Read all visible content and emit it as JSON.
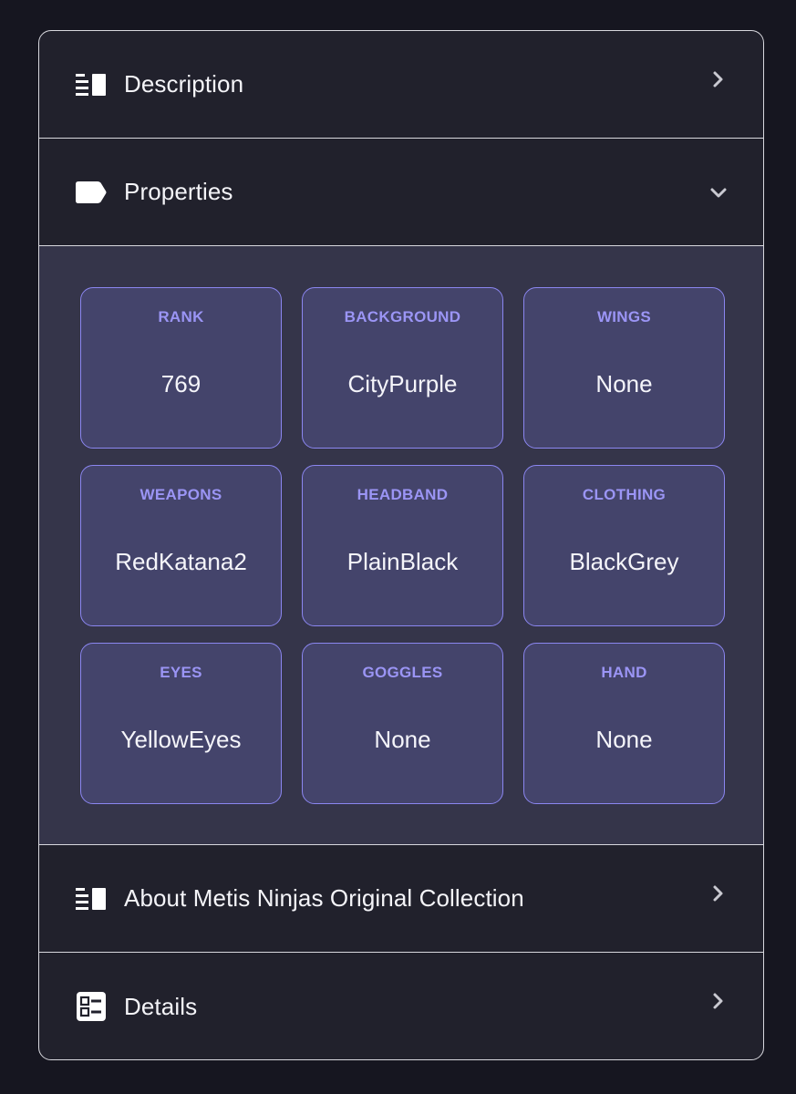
{
  "accordion": {
    "description": {
      "label": "Description",
      "icon": "description-icon",
      "state": "collapsed"
    },
    "properties": {
      "label": "Properties",
      "icon": "tag-icon",
      "state": "expanded",
      "traits": [
        {
          "type": "RANK",
          "value": "769"
        },
        {
          "type": "BACKGROUND",
          "value": "CityPurple"
        },
        {
          "type": "WINGS",
          "value": "None"
        },
        {
          "type": "WEAPONS",
          "value": "RedKatana2"
        },
        {
          "type": "HEADBAND",
          "value": "PlainBlack"
        },
        {
          "type": "CLOTHING",
          "value": "BlackGrey"
        },
        {
          "type": "EYES",
          "value": "YellowEyes"
        },
        {
          "type": "GOGGLES",
          "value": "None"
        },
        {
          "type": "HAND",
          "value": "None"
        }
      ]
    },
    "about": {
      "label": "About Metis Ninjas Original Collection",
      "icon": "description-icon",
      "state": "collapsed"
    },
    "details": {
      "label": "Details",
      "icon": "details-icon",
      "state": "collapsed"
    }
  },
  "colors": {
    "page_background": "#161620",
    "panel_background": "#21212c",
    "properties_background": "#35354a",
    "trait_background": "#44446b",
    "trait_border": "#8b86f0",
    "trait_type_text": "#9b95f5"
  }
}
